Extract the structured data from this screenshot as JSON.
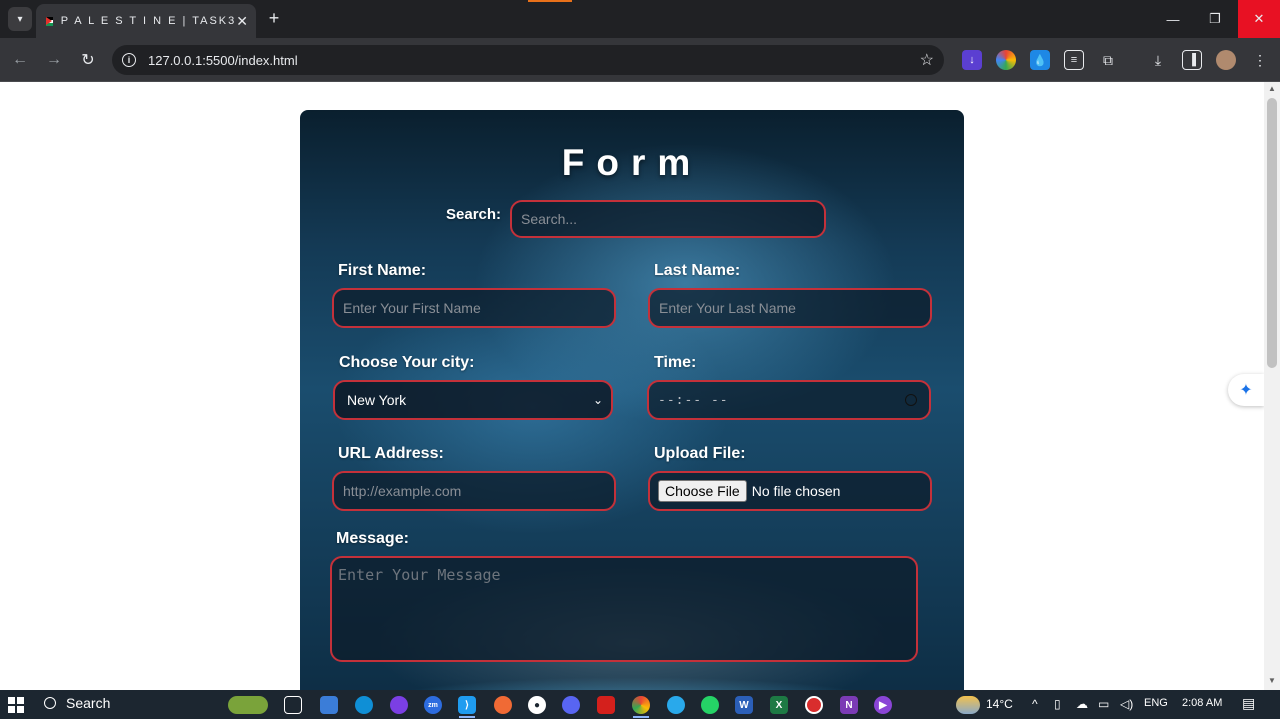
{
  "browser": {
    "tab_title": "P A L E S T I N E | TASK3",
    "tab_close": "✕",
    "new_tab": "+",
    "url": "127.0.0.1:5500/index.html"
  },
  "form": {
    "title": "Form",
    "search_label": "Search:",
    "search_placeholder": "Search...",
    "first_name_label": "First Name:",
    "first_name_placeholder": "Enter Your First Name",
    "last_name_label": "Last Name:",
    "last_name_placeholder": "Enter Your Last Name",
    "city_label": "Choose Your city:",
    "city_value": "New York",
    "time_label": "Time:",
    "time_value": "--:-- --",
    "url_label": "URL Address:",
    "url_placeholder": "http://example.com",
    "file_label": "Upload File:",
    "file_button": "Choose File",
    "file_status": "No file chosen",
    "message_label": "Message:",
    "message_placeholder": "Enter Your Message"
  },
  "taskbar": {
    "search_label": "Search",
    "weather": "14°C",
    "language": "ENG",
    "time": "2:08 AM"
  }
}
